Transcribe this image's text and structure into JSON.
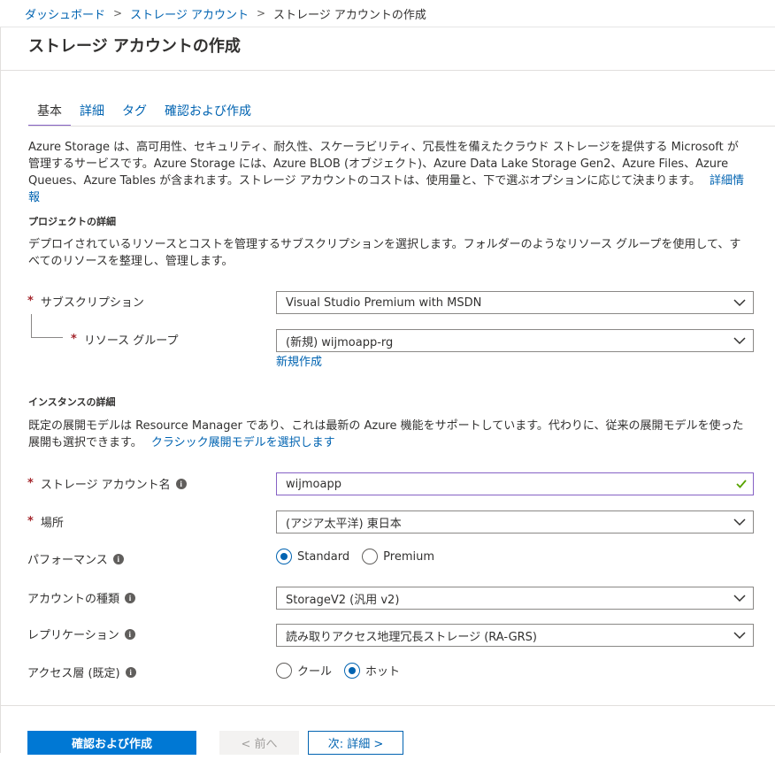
{
  "breadcrumb": {
    "items": [
      "ダッシュボード",
      "ストレージ アカウント"
    ],
    "current": "ストレージ アカウントの作成"
  },
  "page": {
    "title": "ストレージ アカウントの作成"
  },
  "tabs": [
    {
      "label": "基本",
      "active": true
    },
    {
      "label": "詳細",
      "active": false
    },
    {
      "label": "タグ",
      "active": false
    },
    {
      "label": "確認および作成",
      "active": false
    }
  ],
  "intro": {
    "text": "Azure Storage は、高可用性、セキュリティ、耐久性、スケーラビリティ、冗長性を備えたクラウド ストレージを提供する Microsoft が管理するサービスです。Azure Storage には、Azure BLOB (オブジェクト)、Azure Data Lake Storage Gen2、Azure Files、Azure Queues、Azure Tables が含まれます。ストレージ アカウントのコストは、使用量と、下で選ぶオプションに応じて決まります。",
    "link": "詳細情報"
  },
  "project": {
    "section_title": "プロジェクトの詳細",
    "description": "デプロイされているリソースとコストを管理するサブスクリプションを選択します。フォルダーのようなリソース グループを使用して、すべてのリソースを整理し、管理します。",
    "subscription_label": "サブスクリプション",
    "subscription_value": "Visual Studio Premium with MSDN",
    "resource_group_label": "リソース グループ",
    "resource_group_value": "(新規) wijmoapp-rg",
    "create_new_link": "新規作成"
  },
  "instance": {
    "section_title": "インスタンスの詳細",
    "description": "既定の展開モデルは Resource Manager であり、これは最新の Azure 機能をサポートしています。代わりに、従来の展開モデルを使った展開も選択できます。",
    "classic_link": "クラシック展開モデルを選択します",
    "account_name_label": "ストレージ アカウント名",
    "account_name_value": "wijmoapp",
    "location_label": "場所",
    "location_value": "(アジア太平洋) 東日本",
    "performance_label": "パフォーマンス",
    "performance_options": [
      "Standard",
      "Premium"
    ],
    "performance_selected": "Standard",
    "account_kind_label": "アカウントの種類",
    "account_kind_value": "StorageV2 (汎用 v2)",
    "replication_label": "レプリケーション",
    "replication_value": "読み取りアクセス地理冗長ストレージ (RA-GRS)",
    "access_tier_label": "アクセス層 (既定)",
    "access_tier_options": [
      "クール",
      "ホット"
    ],
    "access_tier_selected": "ホット"
  },
  "footer": {
    "review_create": "確認および作成",
    "previous": "< 前へ",
    "next": "次: 詳細 >"
  },
  "required_marker": "*",
  "info_glyph": "i",
  "colors": {
    "accent": "#0078d4",
    "link": "#0063b1",
    "tab_underline": "#8661c5",
    "required": "#a4262c",
    "valid": "#57a300"
  },
  "icons": [
    "chevron-right-icon",
    "chevron-down-icon",
    "info-icon",
    "checkmark-icon"
  ]
}
